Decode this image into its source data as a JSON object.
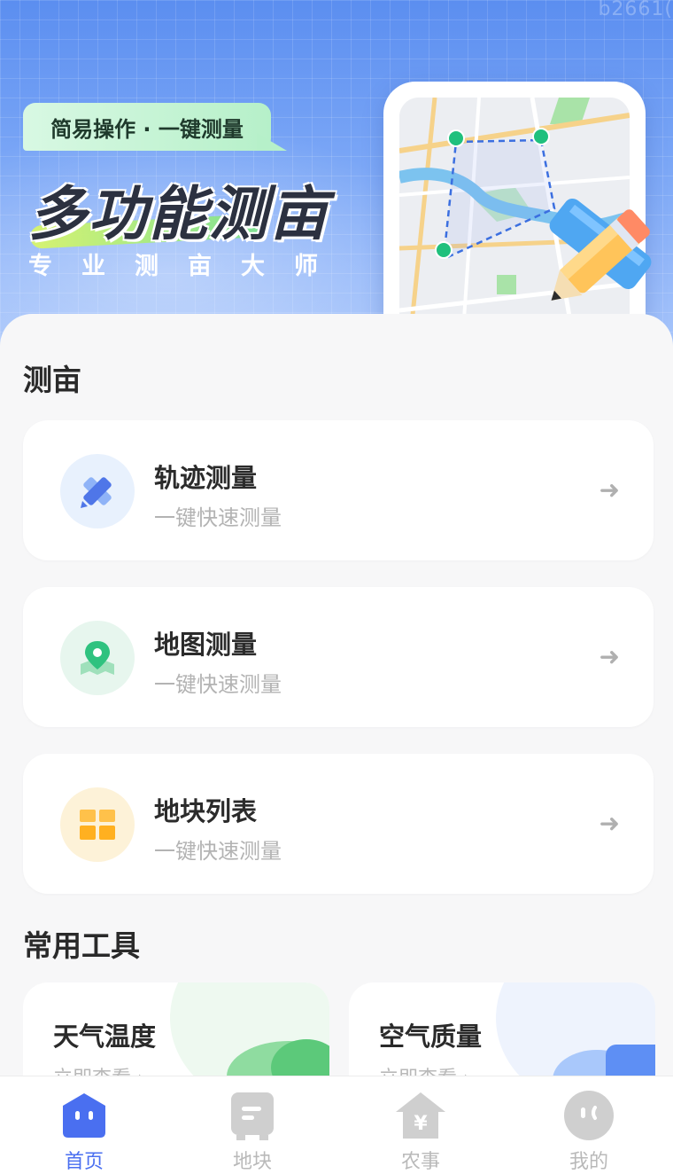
{
  "watermark": "b2661(",
  "hero": {
    "tag": "简易操作 · 一键测量",
    "title": "多功能测亩",
    "subtitle": "专业测亩大师"
  },
  "measure_section": {
    "title": "测亩",
    "items": [
      {
        "title": "轨迹测量",
        "subtitle": "一键快速测量",
        "icon": "pencil-ruler-icon",
        "arrow": "➜"
      },
      {
        "title": "地图测量",
        "subtitle": "一键快速测量",
        "icon": "map-pin-icon",
        "arrow": "➜"
      },
      {
        "title": "地块列表",
        "subtitle": "一键快速测量",
        "icon": "grid-blocks-icon",
        "arrow": "➜"
      }
    ]
  },
  "tools_section": {
    "title": "常用工具",
    "items": [
      {
        "title": "天气温度",
        "link": "立即查看 ›",
        "icon": "weather-cloud-icon"
      },
      {
        "title": "空气质量",
        "link": "立即查看 ›",
        "icon": "air-quality-icon"
      }
    ]
  },
  "bottom_nav": [
    {
      "label": "首页",
      "icon": "home-face-icon",
      "active": true
    },
    {
      "label": "地块",
      "icon": "plot-icon",
      "active": false
    },
    {
      "label": "农事",
      "icon": "farm-house-icon",
      "active": false
    },
    {
      "label": "我的",
      "icon": "profile-face-icon",
      "active": false
    }
  ],
  "colors": {
    "accent": "#4a6ff0",
    "hero_top": "#5b8ef0",
    "tag_green": "#b6f0c9"
  }
}
